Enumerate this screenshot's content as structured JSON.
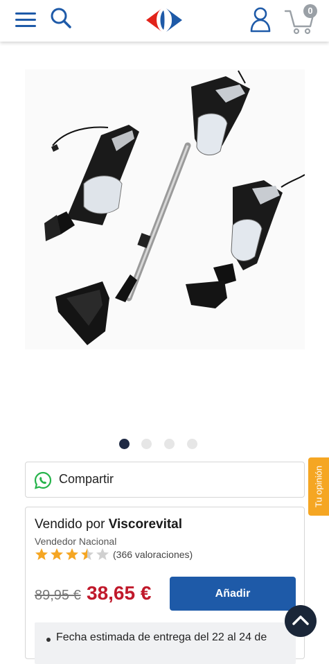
{
  "header": {
    "menu_icon": "hamburger-icon",
    "search_icon": "search-icon",
    "logo": "carrefour-logo",
    "user_icon": "user-icon",
    "cart_icon": "cart-icon",
    "cart_count": "0",
    "brand_color": "#1e5aa8",
    "logo_red": "#e2231a"
  },
  "gallery": {
    "image": "handheld-vacuum-product-image",
    "dots_total": 4,
    "active_index": 0
  },
  "share": {
    "icon": "whatsapp-icon",
    "label": "Compartir"
  },
  "opinion_tab": {
    "label": "Tu opinión",
    "color": "#f5a623"
  },
  "seller": {
    "sold_by_prefix": "Vendido por",
    "seller_name": "Viscorevital",
    "seller_type": "Vendedor Nacional",
    "rating": 3.5,
    "rating_max": 5,
    "ratings_count": "(366 valoraciones)"
  },
  "price": {
    "old": "89,95 €",
    "current": "38,65 €",
    "current_color": "#c0192b"
  },
  "add_button": {
    "label": "Añadir"
  },
  "delivery": {
    "text": "Fecha estimada de entrega del 22 al 24 de"
  },
  "back_to_top": {
    "icon": "chevron-up-icon"
  }
}
